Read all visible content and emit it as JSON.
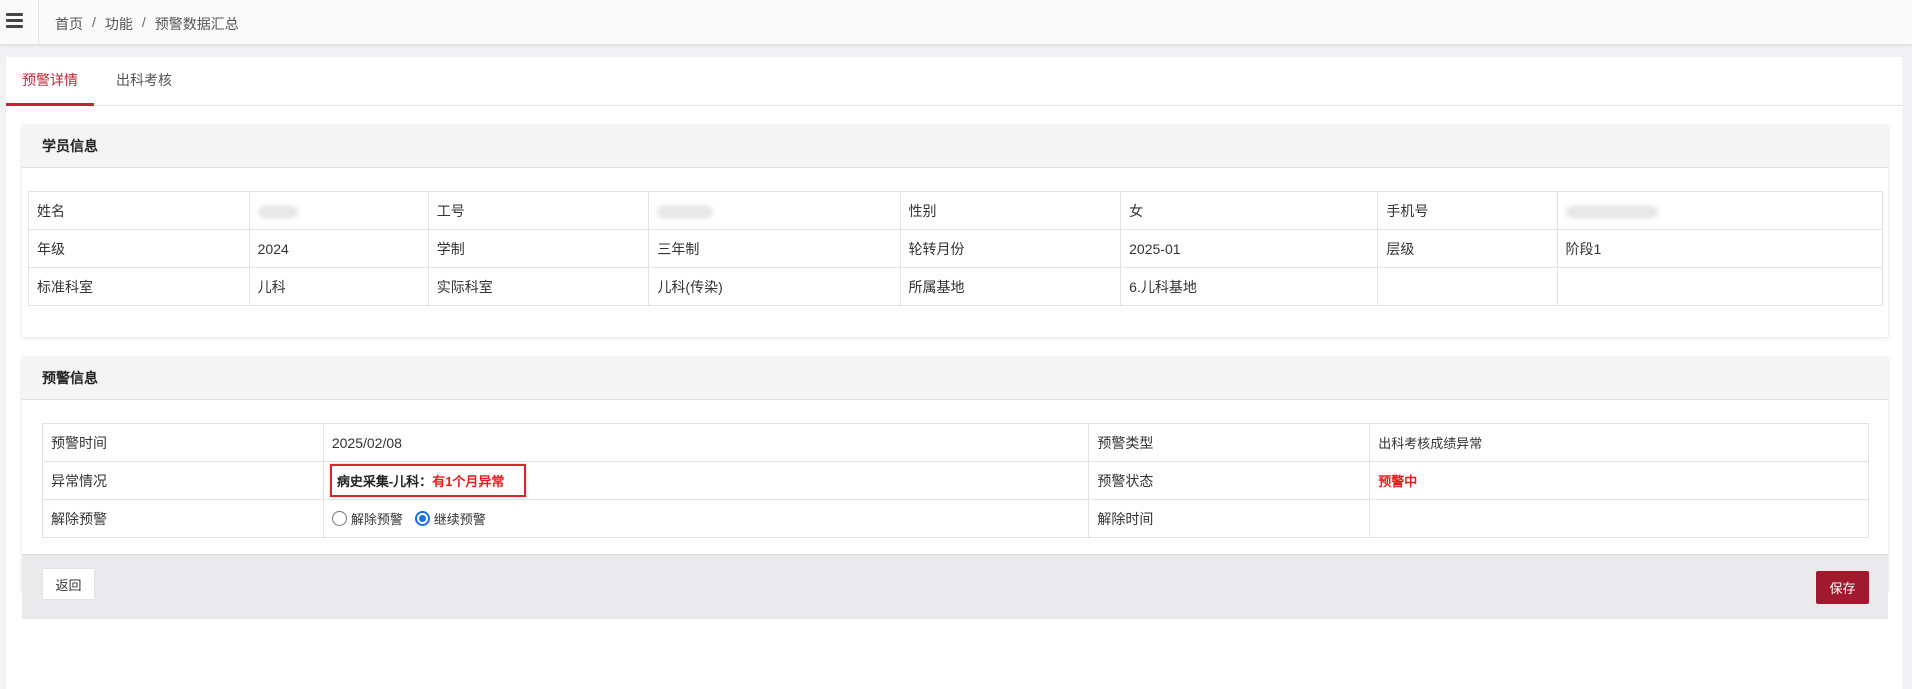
{
  "breadcrumb": [
    "首页",
    "功能",
    "预警数据汇总"
  ],
  "tabs": [
    {
      "label": "预警详情",
      "active": true
    },
    {
      "label": "出科考核",
      "active": false
    }
  ],
  "student": {
    "title": "学员信息",
    "rows": [
      [
        "姓名",
        "",
        "工号",
        "",
        "性别",
        "女",
        "手机号",
        ""
      ],
      [
        "年级",
        "2024",
        "学制",
        "三年制",
        "轮转月份",
        "2025-01",
        "层级",
        "阶段1"
      ],
      [
        "标准科室",
        "儿科",
        "实际科室",
        "儿科(传染)",
        "所属基地",
        "6.儿科基地",
        "",
        ""
      ]
    ]
  },
  "warning": {
    "title": "预警信息",
    "time_label": "预警时间",
    "time_value": "2025/02/08",
    "type_label": "预警类型",
    "type_value": "出科考核成绩异常",
    "abnormal_label": "异常情况",
    "abnormal_prefix": "病史采集-儿科：",
    "abnormal_detail": "有1个月异常",
    "status_label": "预警状态",
    "status_value": "预警中",
    "release_label": "解除预警",
    "release_options": [
      {
        "label": "解除预警",
        "checked": false
      },
      {
        "label": "继续预警",
        "checked": true
      }
    ],
    "release_time_label": "解除时间",
    "release_time_value": ""
  },
  "buttons": {
    "back": "返回",
    "save": "保存"
  },
  "colors": {
    "accent": "#c02535",
    "save_button": "#a0192c",
    "alert_red": "#e51c1c",
    "radio_blue": "#1a6ee6"
  }
}
